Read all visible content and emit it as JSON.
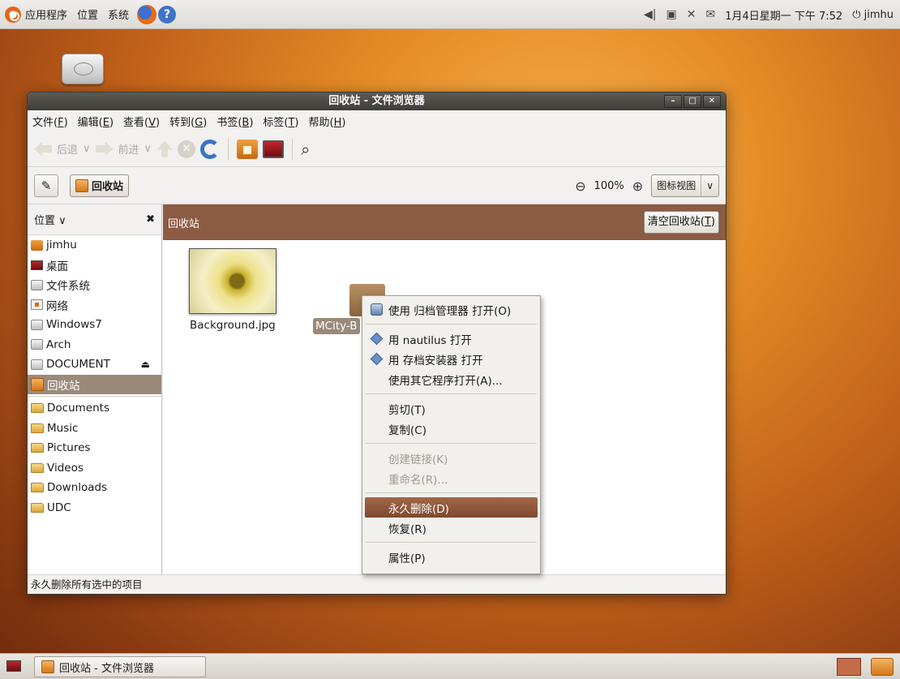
{
  "top_panel": {
    "menus": [
      "应用程序",
      "位置",
      "系统"
    ],
    "clock": "1月4日星期一 下午 7:52",
    "user": "jimhu"
  },
  "window": {
    "title": "回收站 - 文件浏览器",
    "menubar": [
      {
        "label": "文件(",
        "key": "F",
        "end": ")"
      },
      {
        "label": "编辑(",
        "key": "E",
        "end": ")"
      },
      {
        "label": "查看(",
        "key": "V",
        "end": ")"
      },
      {
        "label": "转到(",
        "key": "G",
        "end": ")"
      },
      {
        "label": "书签(",
        "key": "B",
        "end": ")"
      },
      {
        "label": "标签(",
        "key": "T",
        "end": ")"
      },
      {
        "label": "帮助(",
        "key": "H",
        "end": ")"
      }
    ],
    "toolbar": {
      "back": "后退",
      "forward": "前进"
    },
    "location": {
      "current": "回收站",
      "zoom": "100%",
      "view_mode": "图标视图"
    },
    "sidebar": {
      "header": "位置",
      "places": [
        "jimhu",
        "桌面",
        "文件系统",
        "网络",
        "Windows7",
        "Arch",
        "DOCUMENT",
        "回收站"
      ],
      "bookmarks": [
        "Documents",
        "Music",
        "Pictures",
        "Videos",
        "Downloads",
        "UDC"
      ]
    },
    "content": {
      "header": "回收站",
      "empty_button": "清空回收站(",
      "empty_key": "T",
      "files": [
        "Background.jpg",
        "MCity-B"
      ]
    },
    "status": "永久删除所有选中的项目"
  },
  "context_menu": {
    "open_archive": "使用 归档管理器 打开(O)",
    "open_nautilus": "用 nautilus 打开",
    "open_installer": "用 存档安装器 打开",
    "open_other": "使用其它程序打开(A)...",
    "cut": "剪切(T)",
    "copy": "复制(C)",
    "link": "创建链接(K)",
    "rename": "重命名(R)...",
    "delete": "永久删除(D)",
    "restore": "恢复(R)",
    "properties": "属性(P)"
  },
  "taskbar": {
    "task": "回收站 - 文件浏览器"
  }
}
